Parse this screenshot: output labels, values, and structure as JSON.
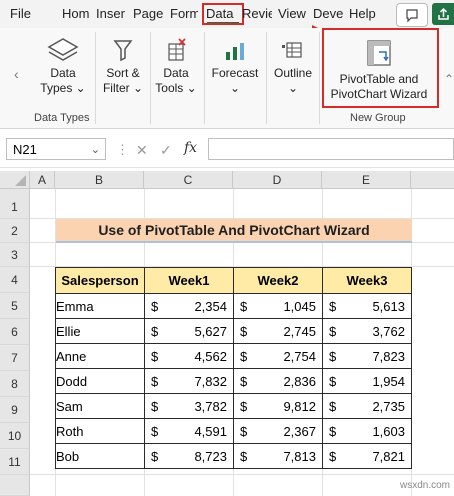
{
  "ribbon_tabs": [
    "File",
    "Hom",
    "Inser",
    "Page",
    "Form",
    "Data",
    "Revie",
    "View",
    "Deve",
    "Help"
  ],
  "ribbon_buttons": {
    "data_types": {
      "line1": "Data",
      "line2": "Types ⌄"
    },
    "sort_filter": {
      "line1": "Sort &",
      "line2": "Filter ⌄"
    },
    "data_tools": {
      "line1": "Data",
      "line2": "Tools ⌄"
    },
    "forecast": {
      "line1": "Forecast",
      "line2": "⌄"
    },
    "outline": {
      "line1": "Outline",
      "line2": "⌄"
    },
    "wizard": {
      "line1": "PivotTable and",
      "line2": "PivotChart Wizard"
    }
  },
  "group_labels": {
    "data_types": "Data Types",
    "new_group": "New Group"
  },
  "formula_bar": {
    "name_box": "N21",
    "cancel": "✕",
    "enter": "✓",
    "fx": "fx"
  },
  "columns": [
    "A",
    "B",
    "C",
    "D",
    "E"
  ],
  "rows": [
    "1",
    "2",
    "3",
    "4",
    "5",
    "6",
    "7",
    "8",
    "9",
    "10",
    "11"
  ],
  "sheet_title": "Use of PivotTable And PivotChart Wizard",
  "table": {
    "headers": [
      "Salesperson",
      "Week1",
      "Week2",
      "Week3"
    ],
    "currency": "$",
    "rows": [
      {
        "name": "Emma",
        "w1": "2,354",
        "w2": "1,045",
        "w3": "5,613"
      },
      {
        "name": "Ellie",
        "w1": "5,627",
        "w2": "2,745",
        "w3": "3,762"
      },
      {
        "name": "Anne",
        "w1": "4,562",
        "w2": "2,754",
        "w3": "7,823"
      },
      {
        "name": "Dodd",
        "w1": "7,832",
        "w2": "2,836",
        "w3": "1,954"
      },
      {
        "name": "Sam",
        "w1": "3,782",
        "w2": "9,812",
        "w3": "2,735"
      },
      {
        "name": "Roth",
        "w1": "4,591",
        "w2": "2,367",
        "w3": "1,603"
      },
      {
        "name": "Bob",
        "w1": "8,723",
        "w2": "7,813",
        "w3": "7,821"
      }
    ]
  },
  "watermark": "wsxdn.com",
  "colors": {
    "accent_green": "#217346",
    "highlight_red": "#d42b2b",
    "title_fill": "#fbd3b1",
    "header_fill": "#ffeaa6"
  }
}
